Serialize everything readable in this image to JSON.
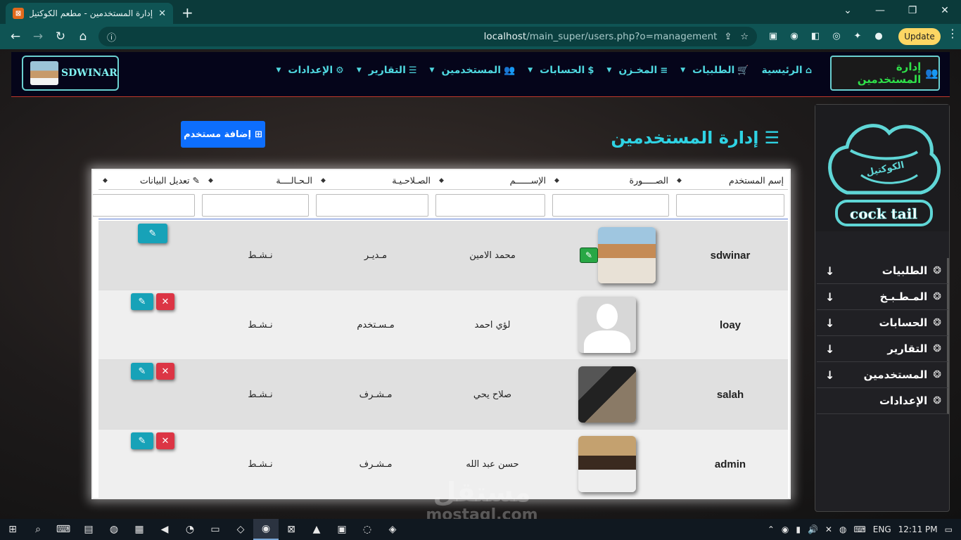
{
  "browser": {
    "tab_title": "إدارة المستخدمين - مطعم الكوكتيل",
    "url_host": "localhost",
    "url_path": "/main_super/users.php?o=management",
    "update_label": "Update"
  },
  "navbar": {
    "brand_name": "SDWINAR",
    "manage_label": "إدارة المستخدمين",
    "menu": [
      {
        "label": "الرئيسية",
        "icon": "home-icon"
      },
      {
        "label": "الطلبيات",
        "icon": "cart-icon"
      },
      {
        "label": "المخـزن",
        "icon": "database-icon"
      },
      {
        "label": "الحسابات",
        "icon": "money-icon"
      },
      {
        "label": "المستخدمين",
        "icon": "users-icon"
      },
      {
        "label": "التقارير",
        "icon": "list-icon"
      },
      {
        "label": "الإعدادات",
        "icon": "gear-icon"
      }
    ]
  },
  "sidebar": {
    "logo_text": "cock tail",
    "logo_arabic": "الكوكتيل",
    "items": [
      {
        "label": "الطلبيات",
        "has_arrow": true
      },
      {
        "label": "المـطـبـخ",
        "has_arrow": true
      },
      {
        "label": "الحسابات",
        "has_arrow": true
      },
      {
        "label": "التقارير",
        "has_arrow": true
      },
      {
        "label": "المستخدمين",
        "has_arrow": true
      },
      {
        "label": "الإعدادات",
        "has_arrow": false
      }
    ]
  },
  "content": {
    "page_title": "إدارة المستخدمين",
    "add_button": "إضافة مستخدم",
    "table": {
      "headers": [
        "إسم المستخدم",
        "الصـــــورة",
        "الإســــــم",
        "الصـلاحـيـة",
        "الـحـالــــة",
        "تعديل البيانات"
      ],
      "rows": [
        {
          "username": "sdwinar",
          "name": "محمد الامين",
          "role": "مـديـر",
          "status": "نـشـط"
        },
        {
          "username": "loay",
          "name": "لؤي احمد",
          "role": "مـسـتخدم",
          "status": "نـشـط"
        },
        {
          "username": "salah",
          "name": "صلاح يحي",
          "role": "مـشـرف",
          "status": "نـشـط"
        },
        {
          "username": "admin",
          "name": "حسن عبد الله",
          "role": "مـشـرف",
          "status": "نـشـط"
        }
      ]
    }
  },
  "watermark": {
    "arabic": "مستقل",
    "latin": "mostaql.com"
  },
  "taskbar": {
    "lang": "ENG",
    "time": "12:11 PM"
  }
}
